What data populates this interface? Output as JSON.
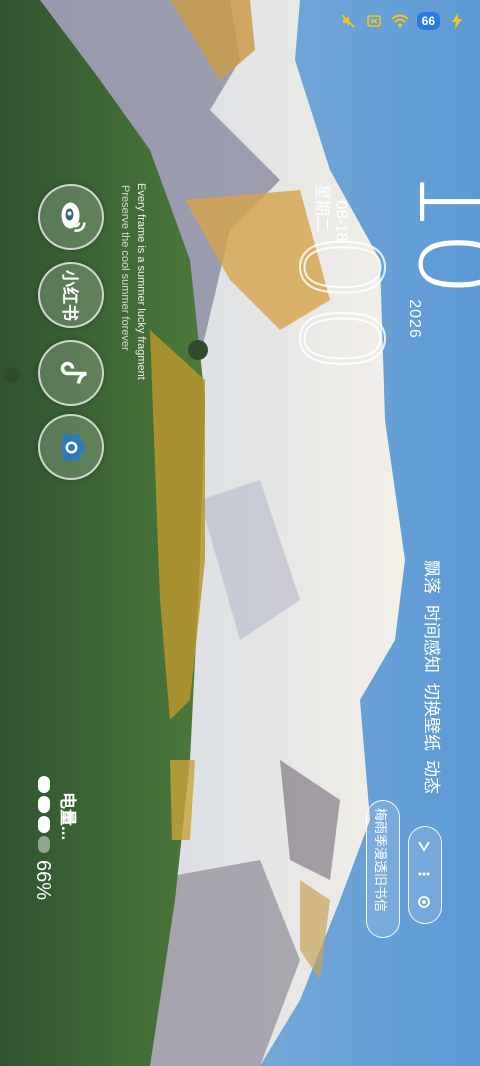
{
  "status_bar": {
    "icons": [
      "mute-icon",
      "sim-off-icon",
      "wifi-icon"
    ],
    "battery": "66",
    "colors": {
      "wifi": "#f5c518",
      "mute": "#f5c518",
      "battery_pill": "#2a7be0"
    }
  },
  "clock": {
    "hour": "10",
    "minute": "00",
    "year": "2026",
    "weekday": "星期二",
    "date": "08-18"
  },
  "slogan": {
    "line1": "Every frame is a summer lucky fragment",
    "line2": "Preserve the cool summer forever"
  },
  "menu": [
    "飘落",
    "时间感知",
    "切换壁纸",
    "动态"
  ],
  "apps": [
    {
      "label": "Weibo",
      "icon": "weibo-icon"
    },
    {
      "label": "小红书",
      "icon": "xiaohongshu-icon"
    },
    {
      "label": "TikTok",
      "icon": "tiktok-icon"
    },
    {
      "label": "Camera",
      "icon": "camera-icon"
    }
  ],
  "music": {
    "song": "梅雨季漫透旧书信",
    "controls": [
      "music-prev-icon",
      "music-play-icon",
      "music-next-icon"
    ]
  },
  "battery_widget": {
    "label": "电量...",
    "percent": "66%",
    "level": 0.66
  }
}
